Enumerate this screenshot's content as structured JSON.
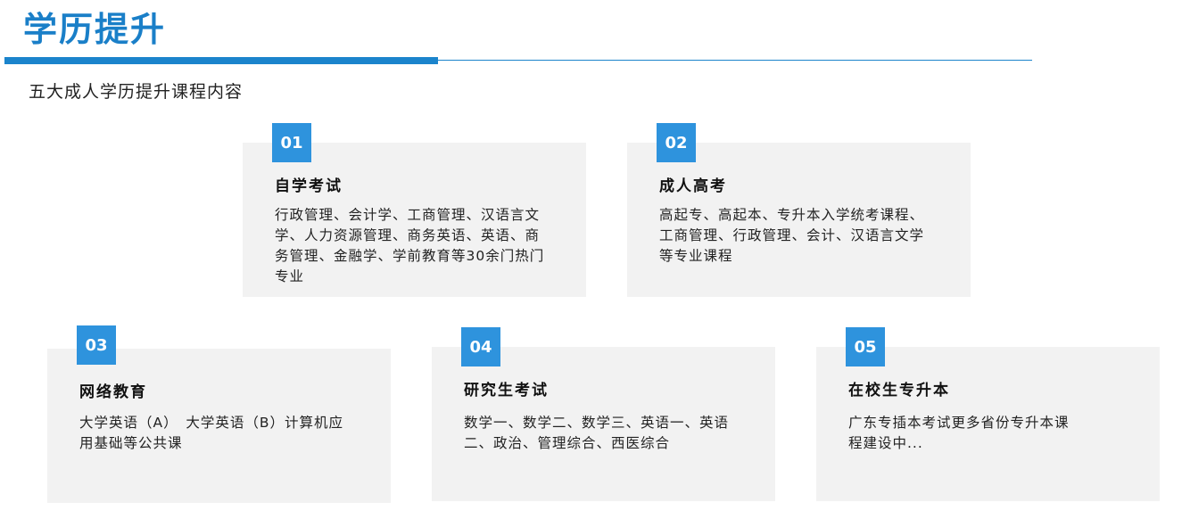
{
  "header": {
    "title": "学历提升",
    "subtitle": "五大成人学历提升课程内容"
  },
  "cards": [
    {
      "number": "01",
      "title": "自学考试",
      "body": "行政管理、会计学、工商管理、汉语言文学、人力资源管理、商务英语、英语、商务管理、金融学、学前教育等30余门热门专业"
    },
    {
      "number": "02",
      "title": "成人高考",
      "body": "高起专、高起本、专升本入学统考课程、工商管理、行政管理、会计、汉语言文学等专业课程"
    },
    {
      "number": "03",
      "title": "网络教育",
      "body": "大学英语（A）　大学英语（B）计算机应用基础等公共课"
    },
    {
      "number": "04",
      "title": "研究生考试",
      "body": "数学一、数学二、数学三、英语一、英语二、政治、管理综合、西医综合"
    },
    {
      "number": "05",
      "title": "在校生专升本",
      "body": "广东专插本考试更多省份专升本课程建设中..."
    }
  ],
  "colors": {
    "accent": "#1b84cc",
    "badge": "#2e93dd",
    "card_bg": "#f2f2f2"
  }
}
